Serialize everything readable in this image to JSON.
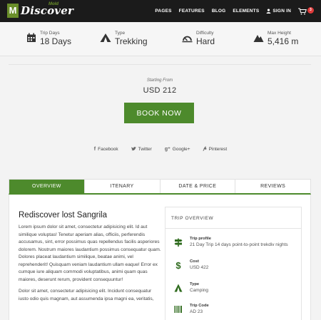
{
  "nav": {
    "logo_letter": "M",
    "logo_name": "Discover",
    "logo_sub": "Mold",
    "links": [
      "PAGES",
      "FEATURES",
      "BLOG",
      "ELEMENTS"
    ],
    "signin": "SIGN IN",
    "cart_count": "3"
  },
  "stats": [
    {
      "label": "Trip Days",
      "value": "18 Days",
      "icon": "calendar-icon"
    },
    {
      "label": "Type",
      "value": "Trekking",
      "icon": "tent-icon"
    },
    {
      "label": "Difficulty",
      "value": "Hard",
      "icon": "difficulty-icon"
    },
    {
      "label": "Max Height",
      "value": "5,416 m",
      "icon": "mountain-icon"
    }
  ],
  "price": {
    "from_label": "Starting From",
    "value": "USD 212",
    "book_label": "BOOK NOW"
  },
  "share": {
    "facebook": "Facebook",
    "twitter": "Twitter",
    "google": "Google+",
    "pinterest": "Pinterest"
  },
  "tabs": [
    "OVERVIEW",
    "ITENARY",
    "DATE & PRICE",
    "REVIEWS"
  ],
  "article": {
    "title": "Rediscover lost Sangrila",
    "p1": "Lorem ipsum dolor sit amet, consectetur adipisicing elit. Id aut similique voluptas! Tenetur aperiam alias, officiis, perferendis accusamus, sint, error possimus quas repellendus facilis asperiores dolorem. Nostrum maiores laudantium possimus consequatur quam. Dolores placeat laudantium similique, beatae animi, vel reprehenderit! Quisquam veniam laudantium ullam eaque! Error ex cumque iure aliquam commodi voluptatibus, animi quam quas maiores, deserunt rerum, provident consequuntur!",
    "p2": "Dolor sit amet, consectetur adipisicing elit. Incidunt consequatur iusto odio quis magnam, aut assumenda ipsa magni ea, veritatis,"
  },
  "overview": {
    "title": "TRIP OVERVIEW",
    "items": [
      {
        "label": "Trip profile",
        "value": "21 Day Trip 14 days point-to-point trekdiv nights",
        "icon": "signpost-icon"
      },
      {
        "label": "Cost",
        "value": "USD 422",
        "icon": "dollar-icon"
      },
      {
        "label": "Type",
        "value": "Camping",
        "icon": "camping-icon"
      },
      {
        "label": "Trip Code",
        "value": "AD 23",
        "icon": "barcode-icon"
      }
    ]
  },
  "colors": {
    "accent": "#4d8a2c",
    "nav_bg": "#1b1b1b",
    "badge": "#e03b3b"
  }
}
